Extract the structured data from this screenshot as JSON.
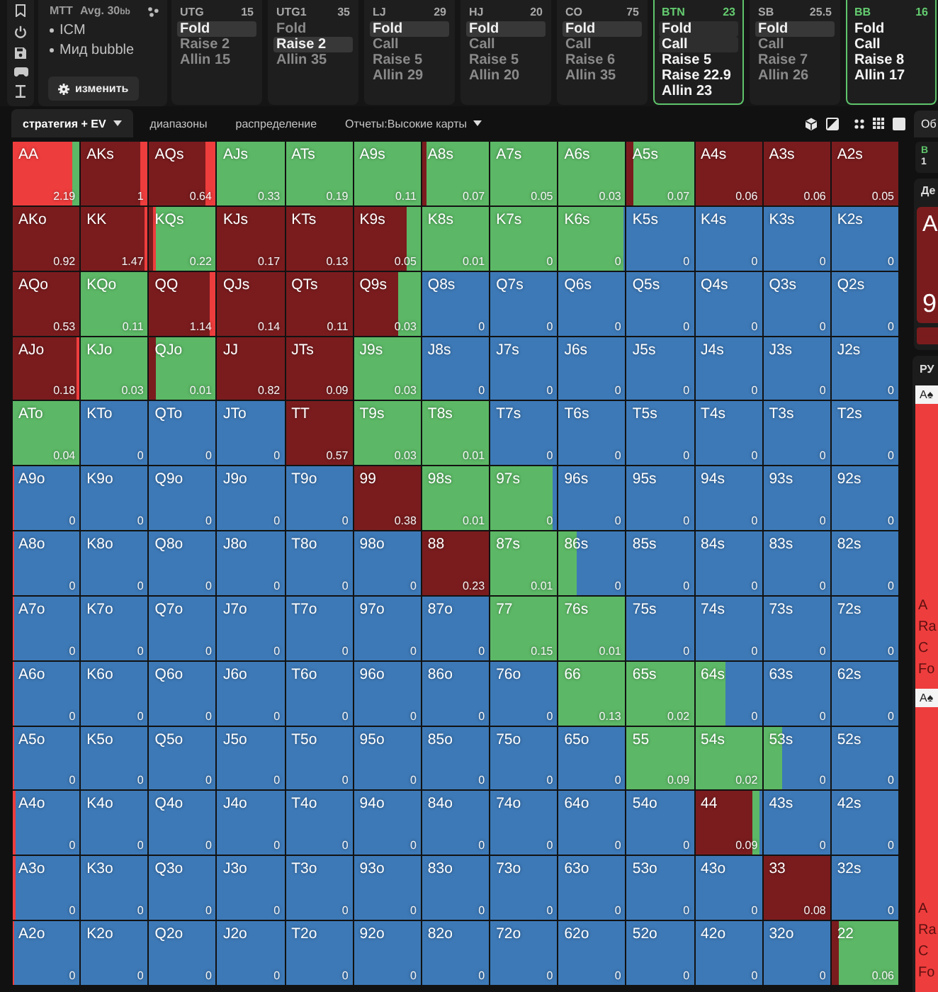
{
  "game": {
    "format": "MTT",
    "stack": "Avg. 30$_{bb}$",
    "tags": [
      "ICM",
      "Мид bubble"
    ],
    "edit_button": "изменить"
  },
  "positions": [
    {
      "name": "UTG",
      "stack": "15",
      "active": false,
      "actions": [
        {
          "label": "Fold",
          "selected": true
        },
        {
          "label": "Raise 2",
          "selected": false
        },
        {
          "label": "Allin 15",
          "selected": false
        }
      ]
    },
    {
      "name": "UTG1",
      "stack": "35",
      "active": false,
      "actions": [
        {
          "label": "Fold",
          "selected": false
        },
        {
          "label": "Raise 2",
          "selected": true
        },
        {
          "label": "Allin 35",
          "selected": false
        }
      ]
    },
    {
      "name": "LJ",
      "stack": "29",
      "active": false,
      "actions": [
        {
          "label": "Fold",
          "selected": true
        },
        {
          "label": "Call",
          "selected": false
        },
        {
          "label": "Raise 5",
          "selected": false
        },
        {
          "label": "Allin 29",
          "selected": false
        }
      ]
    },
    {
      "name": "HJ",
      "stack": "20",
      "active": false,
      "actions": [
        {
          "label": "Fold",
          "selected": true
        },
        {
          "label": "Call",
          "selected": false
        },
        {
          "label": "Raise 5",
          "selected": false
        },
        {
          "label": "Allin 20",
          "selected": false
        }
      ]
    },
    {
      "name": "CO",
      "stack": "75",
      "active": false,
      "actions": [
        {
          "label": "Fold",
          "selected": true
        },
        {
          "label": "Call",
          "selected": false
        },
        {
          "label": "Raise 6",
          "selected": false
        },
        {
          "label": "Allin 35",
          "selected": false
        }
      ]
    },
    {
      "name": "BTN",
      "stack": "23",
      "active": true,
      "actions": [
        {
          "label": "Fold",
          "selected": true
        },
        {
          "label": "Call",
          "selected": true
        },
        {
          "label": "Raise 5",
          "selected": false
        },
        {
          "label": "Raise 22.9",
          "selected": false
        },
        {
          "label": "Allin 23",
          "selected": false
        }
      ]
    },
    {
      "name": "SB",
      "stack": "25.5",
      "active": false,
      "actions": [
        {
          "label": "Fold",
          "selected": true
        },
        {
          "label": "Call",
          "selected": false
        },
        {
          "label": "Raise 7",
          "selected": false
        },
        {
          "label": "Allin 26",
          "selected": false
        }
      ]
    },
    {
      "name": "BB",
      "stack": "16",
      "active": true,
      "actions": [
        {
          "label": "Fold",
          "selected": false
        },
        {
          "label": "Call",
          "selected": false
        },
        {
          "label": "Raise 8",
          "selected": false
        },
        {
          "label": "Allin 17",
          "selected": false
        }
      ]
    }
  ],
  "view_tabs": [
    {
      "label": "стратегия + EV",
      "selected": true,
      "dropdown": true
    },
    {
      "label": "диапазоны",
      "selected": false,
      "dropdown": false
    },
    {
      "label": "распределение",
      "selected": false,
      "dropdown": false
    },
    {
      "label": "Отчеты:Высокие карты",
      "selected": false,
      "dropdown": true
    }
  ],
  "grid": {
    "rows": [
      [
        {
          "hand": "AA",
          "ev": "2.19",
          "mix": [
            {
              "kind": "allin",
              "level": 0.9
            },
            {
              "kind": "call",
              "level": 0.1
            }
          ]
        },
        {
          "hand": "AKs",
          "ev": "1",
          "mix": [
            {
              "kind": "raise",
              "level": 0.88
            },
            {
              "kind": "allin",
              "level": 0.12
            }
          ]
        },
        {
          "hand": "AQs",
          "ev": "0.64",
          "mix": [
            {
              "kind": "raise",
              "level": 0.85
            },
            {
              "kind": "allin",
              "level": 0.15
            }
          ]
        },
        {
          "hand": "AJs",
          "ev": "0.33",
          "mix": [
            {
              "kind": "call",
              "level": 1
            }
          ]
        },
        {
          "hand": "ATs",
          "ev": "0.19",
          "mix": [
            {
              "kind": "call",
              "level": 1
            }
          ]
        },
        {
          "hand": "A9s",
          "ev": "0.11",
          "mix": [
            {
              "kind": "call",
              "level": 1
            }
          ]
        },
        {
          "hand": "A8s",
          "ev": "0.07",
          "mix": [
            {
              "kind": "raise",
              "level": 0.07
            },
            {
              "kind": "call",
              "level": 0.93
            }
          ]
        },
        {
          "hand": "A7s",
          "ev": "0.05",
          "mix": [
            {
              "kind": "call",
              "level": 1
            }
          ]
        },
        {
          "hand": "A6s",
          "ev": "0.03",
          "mix": [
            {
              "kind": "call",
              "level": 1
            }
          ]
        },
        {
          "hand": "A5s",
          "ev": "0.07",
          "mix": [
            {
              "kind": "raise",
              "level": 0.1
            },
            {
              "kind": "call",
              "level": 0.9
            }
          ]
        },
        {
          "hand": "A4s",
          "ev": "0.06",
          "mix": [
            {
              "kind": "raise",
              "level": 1
            }
          ]
        },
        {
          "hand": "A3s",
          "ev": "0.06",
          "mix": [
            {
              "kind": "raise",
              "level": 1
            }
          ]
        },
        {
          "hand": "A2s",
          "ev": "0.05",
          "mix": [
            {
              "kind": "raise",
              "level": 1
            }
          ]
        }
      ],
      [
        {
          "hand": "AKo",
          "ev": "0.92",
          "mix": [
            {
              "kind": "raise",
              "level": 1
            }
          ]
        },
        {
          "hand": "KK",
          "ev": "1.47",
          "mix": [
            {
              "kind": "raise",
              "level": 0.96
            },
            {
              "kind": "allin",
              "level": 0.04
            }
          ]
        },
        {
          "hand": "KQs",
          "ev": "0.22",
          "mix": [
            {
              "kind": "raise",
              "level": 0.06
            },
            {
              "kind": "allin",
              "level": 0.04
            },
            {
              "kind": "call",
              "level": 0.9
            }
          ]
        },
        {
          "hand": "KJs",
          "ev": "0.17",
          "mix": [
            {
              "kind": "raise",
              "level": 1
            }
          ]
        },
        {
          "hand": "KTs",
          "ev": "0.13",
          "mix": [
            {
              "kind": "raise",
              "level": 1
            }
          ]
        },
        {
          "hand": "K9s",
          "ev": "0.05",
          "mix": [
            {
              "kind": "raise",
              "level": 0.78
            },
            {
              "kind": "call",
              "level": 0.22
            }
          ]
        },
        {
          "hand": "K8s",
          "ev": "0.01",
          "mix": [
            {
              "kind": "call",
              "level": 1
            }
          ]
        },
        {
          "hand": "K7s",
          "ev": "0",
          "mix": [
            {
              "kind": "call",
              "level": 1
            }
          ]
        },
        {
          "hand": "K6s",
          "ev": "0",
          "mix": [
            {
              "kind": "call",
              "level": 0.98
            }
          ]
        },
        {
          "hand": "K5s",
          "ev": "0"
        },
        {
          "hand": "K4s",
          "ev": "0"
        },
        {
          "hand": "K3s",
          "ev": "0"
        },
        {
          "hand": "K2s",
          "ev": "0"
        }
      ],
      [
        {
          "hand": "AQo",
          "ev": "0.53",
          "mix": [
            {
              "kind": "raise",
              "level": 1
            }
          ]
        },
        {
          "hand": "KQo",
          "ev": "0.11",
          "mix": [
            {
              "kind": "call",
              "level": 1
            }
          ]
        },
        {
          "hand": "QQ",
          "ev": "1.14",
          "mix": [
            {
              "kind": "raise",
              "level": 0.9
            },
            {
              "kind": "allin",
              "level": 0.1
            }
          ]
        },
        {
          "hand": "QJs",
          "ev": "0.14",
          "mix": [
            {
              "kind": "raise",
              "level": 1
            }
          ]
        },
        {
          "hand": "QTs",
          "ev": "0.11",
          "mix": [
            {
              "kind": "raise",
              "level": 1
            }
          ]
        },
        {
          "hand": "Q9s",
          "ev": "0.03",
          "mix": [
            {
              "kind": "raise",
              "level": 0.67
            },
            {
              "kind": "call",
              "level": 0.33
            }
          ]
        },
        {
          "hand": "Q8s",
          "ev": "0"
        },
        {
          "hand": "Q7s",
          "ev": "0"
        },
        {
          "hand": "Q6s",
          "ev": "0"
        },
        {
          "hand": "Q5s",
          "ev": "0"
        },
        {
          "hand": "Q4s",
          "ev": "0"
        },
        {
          "hand": "Q3s",
          "ev": "0"
        },
        {
          "hand": "Q2s",
          "ev": "0"
        }
      ],
      [
        {
          "hand": "AJo",
          "ev": "0.18",
          "mix": [
            {
              "kind": "raise",
              "level": 0.96
            },
            {
              "kind": "allin",
              "level": 0.04
            }
          ]
        },
        {
          "hand": "KJo",
          "ev": "0.03",
          "mix": [
            {
              "kind": "call",
              "level": 1
            }
          ]
        },
        {
          "hand": "QJo",
          "ev": "0.01",
          "mix": [
            {
              "kind": "raise",
              "level": 0.1
            },
            {
              "kind": "call",
              "level": 0.9
            }
          ]
        },
        {
          "hand": "JJ",
          "ev": "0.82",
          "mix": [
            {
              "kind": "raise",
              "level": 1
            }
          ]
        },
        {
          "hand": "JTs",
          "ev": "0.09",
          "mix": [
            {
              "kind": "raise",
              "level": 1
            }
          ]
        },
        {
          "hand": "J9s",
          "ev": "0.03",
          "mix": [
            {
              "kind": "call",
              "level": 1
            }
          ]
        },
        {
          "hand": "J8s",
          "ev": "0"
        },
        {
          "hand": "J7s",
          "ev": "0"
        },
        {
          "hand": "J6s",
          "ev": "0"
        },
        {
          "hand": "J5s",
          "ev": "0"
        },
        {
          "hand": "J4s",
          "ev": "0"
        },
        {
          "hand": "J3s",
          "ev": "0"
        },
        {
          "hand": "J2s",
          "ev": "0"
        }
      ],
      [
        {
          "hand": "ATo",
          "ev": "0.04",
          "mix": [
            {
              "kind": "call",
              "level": 1
            }
          ]
        },
        {
          "hand": "KTo",
          "ev": "0"
        },
        {
          "hand": "QTo",
          "ev": "0"
        },
        {
          "hand": "JTo",
          "ev": "0"
        },
        {
          "hand": "TT",
          "ev": "0.57",
          "mix": [
            {
              "kind": "raise",
              "level": 1
            }
          ]
        },
        {
          "hand": "T9s",
          "ev": "0.03",
          "mix": [
            {
              "kind": "call",
              "level": 1
            }
          ]
        },
        {
          "hand": "T8s",
          "ev": "0.01",
          "mix": [
            {
              "kind": "call",
              "level": 1
            }
          ]
        },
        {
          "hand": "T7s",
          "ev": "0"
        },
        {
          "hand": "T6s",
          "ev": "0"
        },
        {
          "hand": "T5s",
          "ev": "0"
        },
        {
          "hand": "T4s",
          "ev": "0"
        },
        {
          "hand": "T3s",
          "ev": "0"
        },
        {
          "hand": "T2s",
          "ev": "0"
        }
      ],
      [
        {
          "hand": "A9o",
          "ev": "0",
          "mix": [
            {
              "kind": "allin",
              "level": 0.03
            }
          ]
        },
        {
          "hand": "K9o",
          "ev": "0"
        },
        {
          "hand": "Q9o",
          "ev": "0"
        },
        {
          "hand": "J9o",
          "ev": "0"
        },
        {
          "hand": "T9o",
          "ev": "0"
        },
        {
          "hand": "99",
          "ev": "0.38",
          "mix": [
            {
              "kind": "raise",
              "level": 1
            }
          ]
        },
        {
          "hand": "98s",
          "ev": "0.01",
          "mix": [
            {
              "kind": "call",
              "level": 1
            }
          ]
        },
        {
          "hand": "97s",
          "ev": "0",
          "mix": [
            {
              "kind": "call",
              "level": 0.93
            }
          ]
        },
        {
          "hand": "96s",
          "ev": "0"
        },
        {
          "hand": "95s",
          "ev": "0"
        },
        {
          "hand": "94s",
          "ev": "0"
        },
        {
          "hand": "93s",
          "ev": "0"
        },
        {
          "hand": "92s",
          "ev": "0"
        }
      ],
      [
        {
          "hand": "A8o",
          "ev": "0",
          "mix": [
            {
              "kind": "allin",
              "level": 0.03
            }
          ]
        },
        {
          "hand": "K8o",
          "ev": "0"
        },
        {
          "hand": "Q8o",
          "ev": "0"
        },
        {
          "hand": "J8o",
          "ev": "0"
        },
        {
          "hand": "T8o",
          "ev": "0"
        },
        {
          "hand": "98o",
          "ev": "0"
        },
        {
          "hand": "88",
          "ev": "0.23",
          "mix": [
            {
              "kind": "raise",
              "level": 1
            }
          ]
        },
        {
          "hand": "87s",
          "ev": "0.01",
          "mix": [
            {
              "kind": "call",
              "level": 1
            }
          ]
        },
        {
          "hand": "86s",
          "ev": "0",
          "mix": [
            {
              "kind": "call",
              "level": 0.27
            }
          ]
        },
        {
          "hand": "85s",
          "ev": "0"
        },
        {
          "hand": "84s",
          "ev": "0"
        },
        {
          "hand": "83s",
          "ev": "0"
        },
        {
          "hand": "82s",
          "ev": "0"
        }
      ],
      [
        {
          "hand": "A7o",
          "ev": "0",
          "mix": [
            {
              "kind": "allin",
              "level": 0.03
            }
          ]
        },
        {
          "hand": "K7o",
          "ev": "0"
        },
        {
          "hand": "Q7o",
          "ev": "0"
        },
        {
          "hand": "J7o",
          "ev": "0"
        },
        {
          "hand": "T7o",
          "ev": "0"
        },
        {
          "hand": "97o",
          "ev": "0"
        },
        {
          "hand": "87o",
          "ev": "0"
        },
        {
          "hand": "77",
          "ev": "0.15",
          "mix": [
            {
              "kind": "call",
              "level": 1
            }
          ]
        },
        {
          "hand": "76s",
          "ev": "0.01",
          "mix": [
            {
              "kind": "call",
              "level": 1
            }
          ]
        },
        {
          "hand": "75s",
          "ev": "0"
        },
        {
          "hand": "74s",
          "ev": "0"
        },
        {
          "hand": "73s",
          "ev": "0"
        },
        {
          "hand": "72s",
          "ev": "0"
        }
      ],
      [
        {
          "hand": "A6o",
          "ev": "0",
          "mix": [
            {
              "kind": "allin",
              "level": 0.03
            }
          ]
        },
        {
          "hand": "K6o",
          "ev": "0"
        },
        {
          "hand": "Q6o",
          "ev": "0"
        },
        {
          "hand": "J6o",
          "ev": "0"
        },
        {
          "hand": "T6o",
          "ev": "0"
        },
        {
          "hand": "96o",
          "ev": "0"
        },
        {
          "hand": "86o",
          "ev": "0"
        },
        {
          "hand": "76o",
          "ev": "0"
        },
        {
          "hand": "66",
          "ev": "0.13",
          "mix": [
            {
              "kind": "call",
              "level": 1
            }
          ]
        },
        {
          "hand": "65s",
          "ev": "0.02",
          "mix": [
            {
              "kind": "call",
              "level": 1
            }
          ]
        },
        {
          "hand": "64s",
          "ev": "0",
          "mix": [
            {
              "kind": "call",
              "level": 0.46
            }
          ]
        },
        {
          "hand": "63s",
          "ev": "0"
        },
        {
          "hand": "62s",
          "ev": "0"
        }
      ],
      [
        {
          "hand": "A5o",
          "ev": "0",
          "mix": [
            {
              "kind": "allin",
              "level": 0.03
            }
          ]
        },
        {
          "hand": "K5o",
          "ev": "0"
        },
        {
          "hand": "Q5o",
          "ev": "0"
        },
        {
          "hand": "J5o",
          "ev": "0"
        },
        {
          "hand": "T5o",
          "ev": "0"
        },
        {
          "hand": "95o",
          "ev": "0"
        },
        {
          "hand": "85o",
          "ev": "0"
        },
        {
          "hand": "75o",
          "ev": "0"
        },
        {
          "hand": "65o",
          "ev": "0"
        },
        {
          "hand": "55",
          "ev": "0.09",
          "mix": [
            {
              "kind": "call",
              "level": 1
            }
          ]
        },
        {
          "hand": "54s",
          "ev": "0.02",
          "mix": [
            {
              "kind": "call",
              "level": 1
            }
          ]
        },
        {
          "hand": "53s",
          "ev": "0",
          "mix": [
            {
              "kind": "call",
              "level": 0.28
            }
          ]
        },
        {
          "hand": "52s",
          "ev": "0"
        }
      ],
      [
        {
          "hand": "A4o",
          "ev": "0",
          "mix": [
            {
              "kind": "allin",
              "level": 0.05
            }
          ]
        },
        {
          "hand": "K4o",
          "ev": "0"
        },
        {
          "hand": "Q4o",
          "ev": "0"
        },
        {
          "hand": "J4o",
          "ev": "0"
        },
        {
          "hand": "T4o",
          "ev": "0"
        },
        {
          "hand": "94o",
          "ev": "0"
        },
        {
          "hand": "84o",
          "ev": "0"
        },
        {
          "hand": "74o",
          "ev": "0"
        },
        {
          "hand": "64o",
          "ev": "0"
        },
        {
          "hand": "54o",
          "ev": "0"
        },
        {
          "hand": "44",
          "ev": "0.09",
          "mix": [
            {
              "kind": "raise",
              "level": 0.85
            },
            {
              "kind": "call",
              "level": 0.12
            }
          ]
        },
        {
          "hand": "43s",
          "ev": "0"
        },
        {
          "hand": "42s",
          "ev": "0"
        }
      ],
      [
        {
          "hand": "A3o",
          "ev": "0",
          "mix": [
            {
              "kind": "allin",
              "level": 0.04
            }
          ]
        },
        {
          "hand": "K3o",
          "ev": "0"
        },
        {
          "hand": "Q3o",
          "ev": "0"
        },
        {
          "hand": "J3o",
          "ev": "0"
        },
        {
          "hand": "T3o",
          "ev": "0"
        },
        {
          "hand": "93o",
          "ev": "0"
        },
        {
          "hand": "83o",
          "ev": "0"
        },
        {
          "hand": "73o",
          "ev": "0"
        },
        {
          "hand": "63o",
          "ev": "0"
        },
        {
          "hand": "53o",
          "ev": "0"
        },
        {
          "hand": "43o",
          "ev": "0"
        },
        {
          "hand": "33",
          "ev": "0.08",
          "mix": [
            {
              "kind": "raise",
              "level": 1
            }
          ]
        },
        {
          "hand": "32s",
          "ev": "0"
        }
      ],
      [
        {
          "hand": "A2o",
          "ev": "0",
          "mix": [
            {
              "kind": "allin",
              "level": 0.03
            }
          ]
        },
        {
          "hand": "K2o",
          "ev": "0"
        },
        {
          "hand": "Q2o",
          "ev": "0"
        },
        {
          "hand": "J2o",
          "ev": "0"
        },
        {
          "hand": "T2o",
          "ev": "0"
        },
        {
          "hand": "92o",
          "ev": "0"
        },
        {
          "hand": "82o",
          "ev": "0"
        },
        {
          "hand": "72o",
          "ev": "0"
        },
        {
          "hand": "62o",
          "ev": "0"
        },
        {
          "hand": "52o",
          "ev": "0"
        },
        {
          "hand": "42o",
          "ev": "0"
        },
        {
          "hand": "32o",
          "ev": "0"
        },
        {
          "hand": "22",
          "ev": "0.06",
          "mix": [
            {
              "kind": "raise",
              "level": 0.1
            },
            {
              "kind": "call",
              "level": 0.9
            }
          ]
        }
      ]
    ]
  },
  "side_panel": {
    "tab": "Об",
    "chip": {
      "label": "B",
      "value": "1"
    },
    "detail": {
      "title": "Де",
      "hand": "A",
      "value": "9"
    },
    "combos_title": "РУ",
    "combos": [
      {
        "card": "A♠",
        "lines": [
          "A",
          "Ra",
          "C",
          "Fo"
        ]
      },
      {
        "card": "A♠",
        "lines": [
          "A",
          "Ra",
          "C",
          "Fo"
        ]
      }
    ]
  }
}
